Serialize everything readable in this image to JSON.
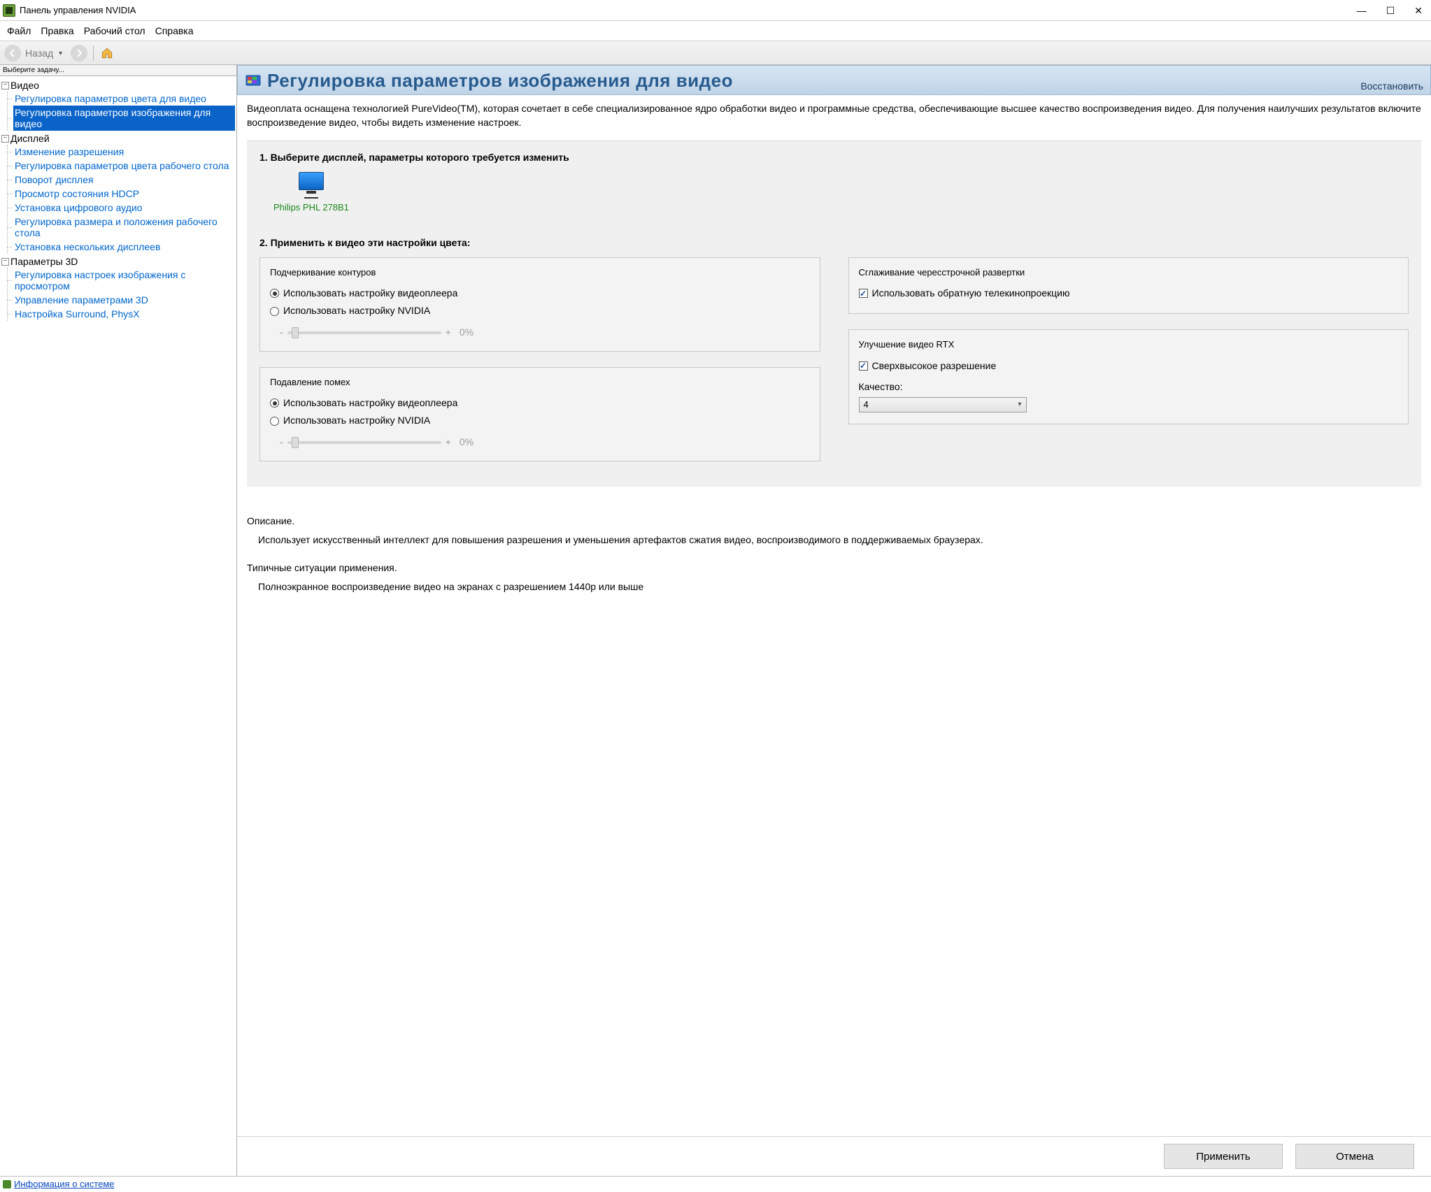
{
  "window": {
    "title": "Панель управления NVIDIA"
  },
  "menu": {
    "file": "Файл",
    "edit": "Правка",
    "desktop": "Рабочий стол",
    "help": "Справка"
  },
  "toolbar": {
    "back_label": "Назад"
  },
  "sidebar": {
    "header": "Выберите задачу...",
    "groups": [
      {
        "label": "Видео",
        "items": [
          "Регулировка параметров цвета для видео",
          "Регулировка параметров изображения для видео"
        ],
        "selected_index": 1
      },
      {
        "label": "Дисплей",
        "items": [
          "Изменение разрешения",
          "Регулировка параметров цвета рабочего стола",
          "Поворот дисплея",
          "Просмотр состояния HDCP",
          "Установка цифрового аудио",
          "Регулировка размера и положения рабочего стола",
          "Установка нескольких дисплеев"
        ]
      },
      {
        "label": "Параметры 3D",
        "items": [
          "Регулировка настроек изображения с просмотром",
          "Управление параметрами 3D",
          "Настройка Surround, PhysX"
        ]
      }
    ]
  },
  "page": {
    "title": "Регулировка параметров изображения для видео",
    "restore": "Восстановить",
    "intro": "Видеоплата оснащена технологией PureVideo(TM), которая сочетает в себе специализированное ядро обработки видео и программные средства, обеспечивающие высшее качество воспроизведения видео. Для получения наилучших результатов включите воспроизведение видео, чтобы видеть изменение настроек.",
    "step1_heading": "1. Выберите дисплей, параметры которого требуется изменить",
    "display_name": "Philips PHL 278B1",
    "step2_heading": "2. Применить к видео эти настройки цвета:",
    "edge_group": {
      "title": "Подчеркивание контуров",
      "opt_player": "Использовать настройку видеоплеера",
      "opt_nvidia": "Использовать настройку NVIDIA",
      "slider_min": "-",
      "slider_max": "+",
      "slider_value": "0%"
    },
    "noise_group": {
      "title": "Подавление помех",
      "opt_player": "Использовать настройку видеоплеера",
      "opt_nvidia": "Использовать настройку NVIDIA",
      "slider_min": "-",
      "slider_max": "+",
      "slider_value": "0%"
    },
    "deinterlace_group": {
      "title": "Сглаживание чересстрочной развертки",
      "chk_inverse": "Использовать обратную телекинопроекцию"
    },
    "rtx_group": {
      "title": "Улучшение видео RTX",
      "chk_super": "Сверхвысокое разрешение",
      "quality_label": "Качество:",
      "quality_value": "4"
    },
    "desc_heading": "Описание.",
    "desc_text": "Использует искусственный интеллект для повышения разрешения и уменьшения артефактов сжатия видео, воспроизводимого в поддерживаемых браузерах.",
    "use_heading": "Типичные ситуации применения.",
    "use_text": "Полноэкранное воспроизведение видео на экранах с разрешением 1440p или выше"
  },
  "buttons": {
    "apply": "Применить",
    "cancel": "Отмена"
  },
  "statusbar": {
    "sysinfo": "Информация о системе"
  }
}
